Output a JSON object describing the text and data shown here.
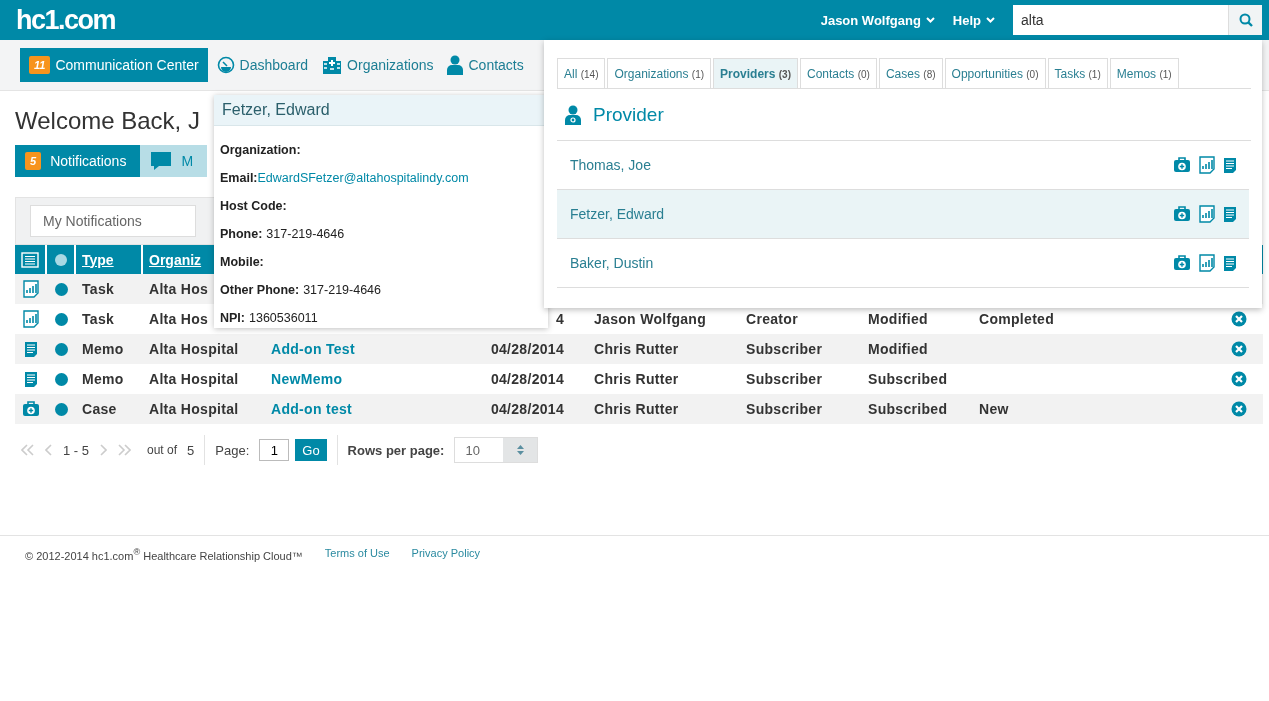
{
  "header": {
    "logo": "hc1.com",
    "user_menu": "Jason Wolfgang",
    "help_menu": "Help",
    "search": {
      "value": "alta"
    }
  },
  "nav": [
    {
      "kind": "comm",
      "label": "Communication Center",
      "badge": "11",
      "selected": true
    },
    {
      "kind": "dashboard",
      "label": "Dashboard",
      "selected": false
    },
    {
      "kind": "orgs",
      "label": "Organizations",
      "selected": false
    },
    {
      "kind": "contacts",
      "label": "Contacts",
      "selected": false
    }
  ],
  "welcome": "Welcome Back, J",
  "tabs": [
    {
      "label": "Notifications",
      "badge": "5",
      "selected": true
    },
    {
      "label": "M",
      "selected": false
    }
  ],
  "filter": {
    "placeholder": "My Notifications"
  },
  "table": {
    "columns": [
      "Type",
      "Organiz"
    ],
    "rows": [
      {
        "kind": "task",
        "unread": true,
        "type": "Task",
        "organization": "Alta Hos"
      },
      {
        "kind": "task",
        "unread": true,
        "type": "Task",
        "organization": "Alta Hos",
        "date": "4",
        "person": "Jason Wolfgang",
        "role": "Creator",
        "status": "Modified",
        "case_status": "Completed"
      },
      {
        "kind": "memo",
        "unread": true,
        "type": "Memo",
        "organization": "Alta Hospital",
        "subject": "Add-on Test",
        "date": "04/28/2014",
        "person": "Chris Rutter",
        "role": "Subscriber",
        "status": "Modified"
      },
      {
        "kind": "memo",
        "unread": true,
        "type": "Memo",
        "organization": "Alta Hospital",
        "subject": "NewMemo",
        "date": "04/28/2014",
        "person": "Chris Rutter",
        "role": "Subscriber",
        "status": "Subscribed"
      },
      {
        "kind": "case",
        "unread": true,
        "type": "Case",
        "organization": "Alta Hospital",
        "subject": "Add-on test",
        "date": "04/28/2014",
        "person": "Chris Rutter",
        "role": "Subscriber",
        "status": "Subscribed",
        "case_status": "New"
      }
    ]
  },
  "pager": {
    "range": "1 - 5",
    "out_of": "out of",
    "total": "5",
    "page_label": "Page:",
    "page": "1",
    "go": "Go",
    "rows_label": "Rows per page:",
    "rows": "10"
  },
  "footer": {
    "copyright": "© 2012-2014 hc1.com$^{®}$ Healthcare Relationship Cloud™",
    "links": [
      "Terms of Use",
      "Privacy Policy"
    ]
  },
  "popover": {
    "title": "Fetzer, Edward",
    "fields": [
      {
        "label": "Organization:"
      },
      {
        "label": "Email:",
        "value": "EdwardSFetzer@altahospitalindy.com",
        "kind": "link"
      },
      {
        "label": "Host Code:"
      },
      {
        "label": "Phone:",
        "value": "317-219-4646",
        "kind": "text"
      },
      {
        "label": "Mobile:"
      },
      {
        "label": "Other Phone:",
        "value": "317-219-4646",
        "kind": "text"
      },
      {
        "label": "NPI:",
        "value": "1360536011",
        "kind": "text"
      }
    ]
  },
  "results": {
    "tabs": [
      {
        "label": "All",
        "count": "(14)",
        "selected": false
      },
      {
        "label": "Organizations",
        "count": "(1)",
        "selected": false
      },
      {
        "label": "Providers",
        "count": "(3)",
        "selected": true
      },
      {
        "label": "Contacts",
        "count": "(0)",
        "selected": false
      },
      {
        "label": "Cases",
        "count": "(8)",
        "selected": false
      },
      {
        "label": "Opportunities",
        "count": "(0)",
        "selected": false
      },
      {
        "label": "Tasks",
        "count": "(1)",
        "selected": false
      },
      {
        "label": "Memos",
        "count": "(1)",
        "selected": false
      }
    ],
    "heading": "Provider",
    "items": [
      {
        "name": "Thomas, Joe",
        "selected": false
      },
      {
        "name": "Fetzer, Edward",
        "selected": true
      },
      {
        "name": "Baker, Dustin",
        "selected": false
      }
    ]
  }
}
